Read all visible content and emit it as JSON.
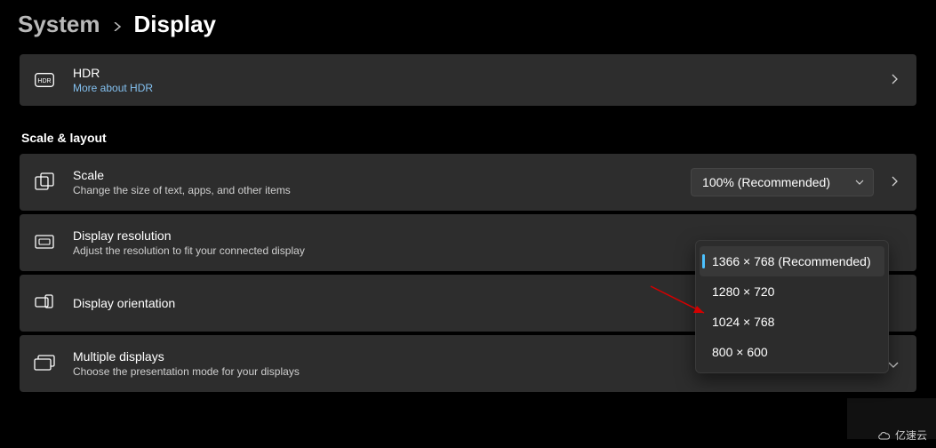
{
  "breadcrumb": {
    "parent": "System",
    "current": "Display"
  },
  "hdr": {
    "title": "HDR",
    "subtitle": "More about HDR"
  },
  "section_scale_layout": "Scale & layout",
  "scale": {
    "title": "Scale",
    "subtitle": "Change the size of text, apps, and other items",
    "selected": "100% (Recommended)"
  },
  "resolution": {
    "title": "Display resolution",
    "subtitle": "Adjust the resolution to fit your connected display",
    "options": [
      "1366 × 768 (Recommended)",
      "1280 × 720",
      "1024 × 768",
      "800 × 600"
    ],
    "selected_index": 0
  },
  "orientation": {
    "title": "Display orientation"
  },
  "multiple": {
    "title": "Multiple displays",
    "subtitle": "Choose the presentation mode for your displays"
  },
  "watermark": "亿速云"
}
